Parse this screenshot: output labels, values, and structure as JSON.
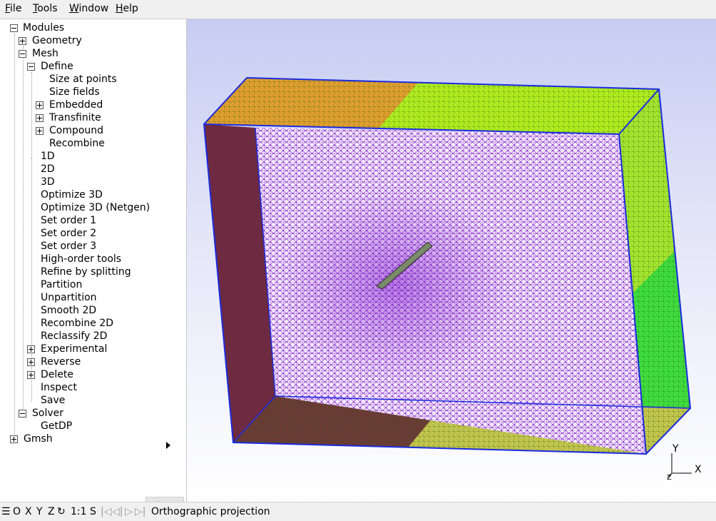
{
  "menubar": {
    "file": {
      "u": "F",
      "rest": "ile"
    },
    "tools": {
      "u": "T",
      "rest": "ools"
    },
    "window": {
      "u": "W",
      "rest": "indow"
    },
    "help": {
      "u": "H",
      "rest": "elp"
    }
  },
  "tree": {
    "modules": "Modules",
    "geometry": "Geometry",
    "mesh": "Mesh",
    "define": "Define",
    "size_at_points": "Size at points",
    "size_fields": "Size fields",
    "embedded": "Embedded",
    "transfinite": "Transfinite",
    "compound": "Compound",
    "recombine": "Recombine",
    "m1d": "1D",
    "m2d": "2D",
    "m3d": "3D",
    "optimize_3d": "Optimize 3D",
    "optimize_3d_netgen": "Optimize 3D (Netgen)",
    "set_order_1": "Set order 1",
    "set_order_2": "Set order 2",
    "set_order_3": "Set order 3",
    "high_order_tools": "High-order tools",
    "refine_by_splitting": "Refine by splitting",
    "partition": "Partition",
    "unpartition": "Unpartition",
    "smooth_2d": "Smooth 2D",
    "recombine_2d": "Recombine 2D",
    "reclassify_2d": "Reclassify 2D",
    "experimental": "Experimental",
    "reverse": "Reverse",
    "delete": "Delete",
    "inspect": "Inspect",
    "save": "Save",
    "solver": "Solver",
    "getdp": "GetDP",
    "gmsh": "Gmsh"
  },
  "axes": {
    "y": "Y",
    "x": "X",
    "z": "Z"
  },
  "statusbar": {
    "menu_icon": "☰",
    "o": "O",
    "x": "X",
    "y": "Y",
    "z": "Z",
    "rotate_icon": "↻",
    "scale": "1:1",
    "s": "S",
    "first_icon": "|◁",
    "prev_icon": "◁|",
    "next_icon": "▷",
    "last_icon": "▷|",
    "status_text": "Orthographic projection"
  },
  "colors": {
    "mesh_purple": "#7a10c8",
    "mesh_edge_blue": "#1a2be0",
    "face_orange": "#e6a030",
    "face_yellow_green": "#b4f020",
    "face_green": "#30e040",
    "face_brown": "#7a3a3a"
  }
}
